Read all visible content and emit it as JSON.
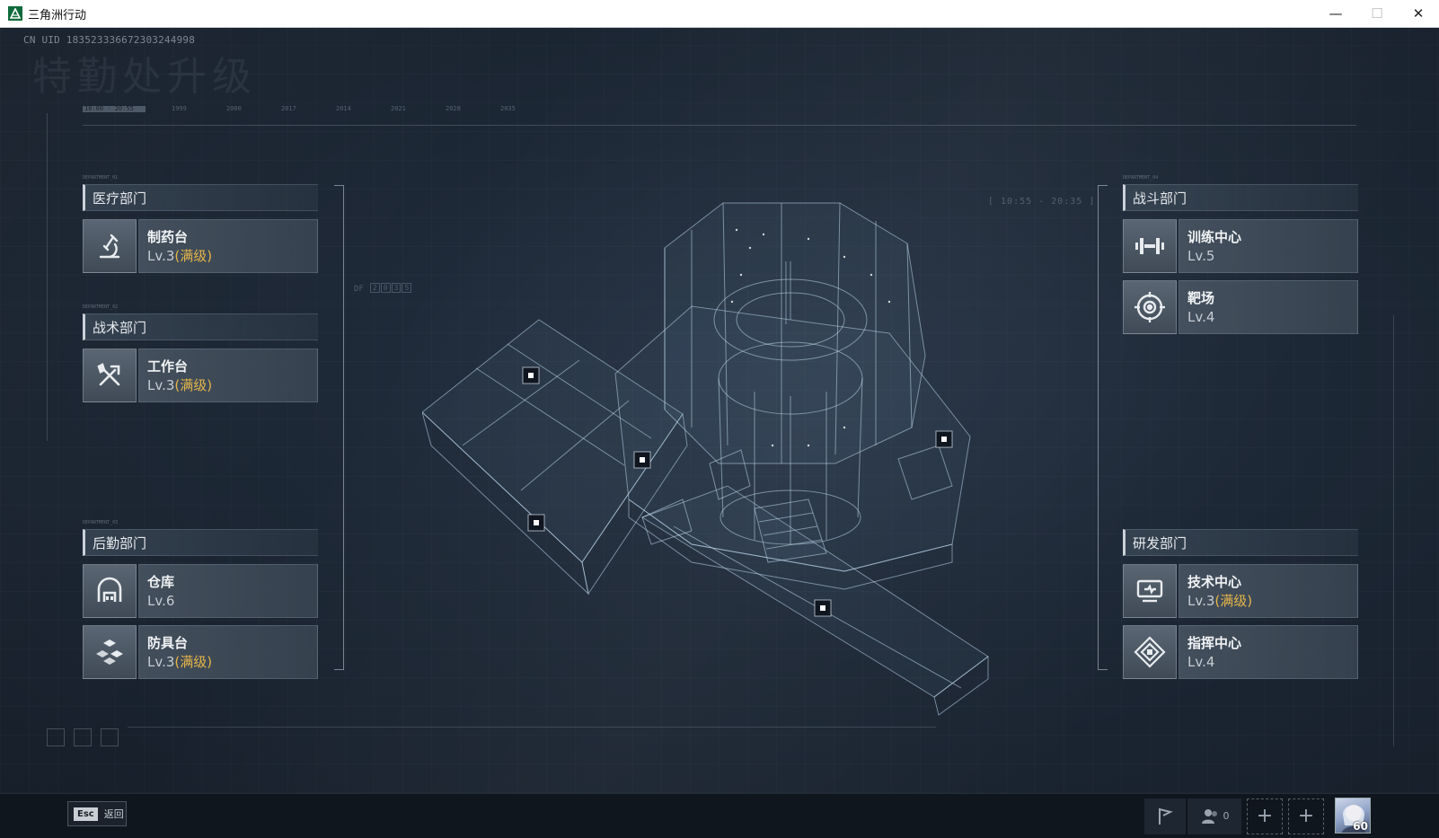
{
  "window": {
    "title": "三角洲行动",
    "minimize": "—",
    "maximize": "☐",
    "close": "✕"
  },
  "header": {
    "uid": "CN UID 1835233366723032449​98",
    "page_title": "特勤处升级",
    "timeline_ticks": [
      "10:00 - 20:55",
      "1999",
      "2000",
      "2017",
      "2014",
      "2021",
      "2028",
      "2035"
    ]
  },
  "departments": {
    "medical": {
      "title": "医疗部门",
      "code": "DEPARTMENT_01",
      "facilities": [
        {
          "name": "制药台",
          "level": "Lv.3",
          "max": "(满级)",
          "icon": "microscope-icon"
        }
      ]
    },
    "tactical": {
      "title": "战术部门",
      "code": "DEPARTMENT_02",
      "facilities": [
        {
          "name": "工作台",
          "level": "Lv.3",
          "max": "(满级)",
          "icon": "tools-icon"
        }
      ]
    },
    "logistics": {
      "title": "后勤部门",
      "code": "DEPARTMENT_03",
      "facilities": [
        {
          "name": "仓库",
          "level": "Lv.6",
          "max": "",
          "icon": "warehouse-icon"
        },
        {
          "name": "防具台",
          "level": "Lv.3",
          "max": "(满级)",
          "icon": "armor-icon"
        }
      ]
    },
    "combat": {
      "title": "战斗部门",
      "code": "DEPARTMENT_04",
      "facilities": [
        {
          "name": "训练中心",
          "level": "Lv.5",
          "max": "",
          "icon": "dumbbell-icon"
        },
        {
          "name": "靶场",
          "level": "Lv.4",
          "max": "",
          "icon": "target-icon"
        }
      ]
    },
    "research": {
      "title": "研发部门",
      "facilities": [
        {
          "name": "技术中心",
          "level": "Lv.3",
          "max": "(满级)",
          "icon": "computer-icon"
        },
        {
          "name": "指挥中心",
          "level": "Lv.4",
          "max": "",
          "icon": "command-icon"
        }
      ]
    }
  },
  "hud": {
    "time_readout": "[ 10:55 - 20:35 ]",
    "df_label": "DF",
    "df_digits": [
      "2",
      "0",
      "3",
      "5"
    ]
  },
  "bottombar": {
    "esc_key": "Esc",
    "esc_label": "返回",
    "friend_count": "0",
    "player_level": "60"
  },
  "colors": {
    "max_level": "#e5b54a",
    "background": "#1a2330"
  }
}
